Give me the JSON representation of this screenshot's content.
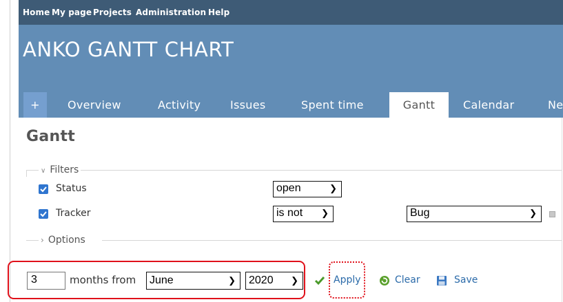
{
  "top_menu": {
    "home": "Home",
    "my_page": "My page",
    "projects": "Projects",
    "administration": "Administration",
    "help": "Help"
  },
  "project_title": "ANKO GANTT CHART",
  "tabs": {
    "new": "+",
    "overview": "Overview",
    "activity": "Activity",
    "issues": "Issues",
    "spent_time": "Spent time",
    "gantt": "Gantt",
    "calendar": "Calendar",
    "news_partial": "Ne"
  },
  "page_title": "Gantt",
  "filters": {
    "legend": "Filters",
    "status": {
      "label": "Status",
      "operator": "open"
    },
    "tracker": {
      "label": "Tracker",
      "operator": "is not",
      "value": "Bug"
    }
  },
  "options": {
    "legend": "Options"
  },
  "period": {
    "months_value": "3",
    "months_from_label": "months from",
    "month": "June",
    "year": "2020"
  },
  "actions": {
    "apply": "Apply",
    "clear": "Clear",
    "save": "Save"
  },
  "colors": {
    "top_menu_bg": "#3e5b76",
    "header_bg": "#628db6",
    "highlight": "#e0101a",
    "link": "#2a6aa9"
  }
}
